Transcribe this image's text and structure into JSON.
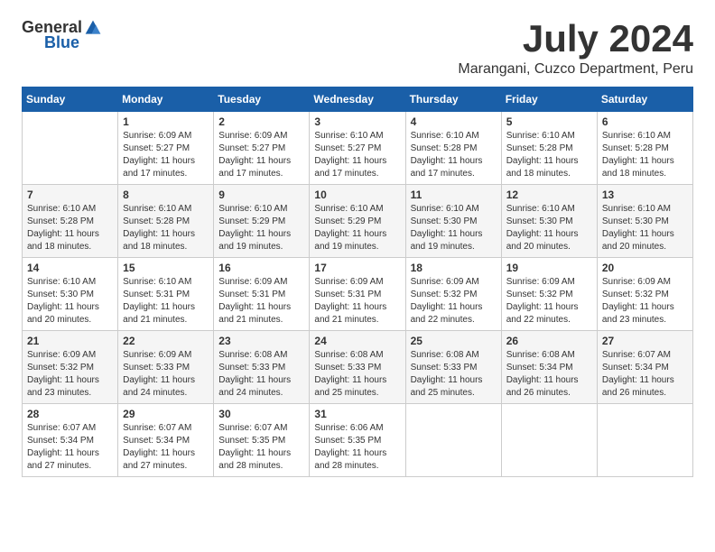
{
  "logo": {
    "text_general": "General",
    "text_blue": "Blue"
  },
  "title": {
    "month_year": "July 2024",
    "location": "Marangani, Cuzco Department, Peru"
  },
  "calendar": {
    "headers": [
      "Sunday",
      "Monday",
      "Tuesday",
      "Wednesday",
      "Thursday",
      "Friday",
      "Saturday"
    ],
    "weeks": [
      [
        {
          "day": "",
          "info": ""
        },
        {
          "day": "1",
          "info": "Sunrise: 6:09 AM\nSunset: 5:27 PM\nDaylight: 11 hours\nand 17 minutes."
        },
        {
          "day": "2",
          "info": "Sunrise: 6:09 AM\nSunset: 5:27 PM\nDaylight: 11 hours\nand 17 minutes."
        },
        {
          "day": "3",
          "info": "Sunrise: 6:10 AM\nSunset: 5:27 PM\nDaylight: 11 hours\nand 17 minutes."
        },
        {
          "day": "4",
          "info": "Sunrise: 6:10 AM\nSunset: 5:28 PM\nDaylight: 11 hours\nand 17 minutes."
        },
        {
          "day": "5",
          "info": "Sunrise: 6:10 AM\nSunset: 5:28 PM\nDaylight: 11 hours\nand 18 minutes."
        },
        {
          "day": "6",
          "info": "Sunrise: 6:10 AM\nSunset: 5:28 PM\nDaylight: 11 hours\nand 18 minutes."
        }
      ],
      [
        {
          "day": "7",
          "info": "Sunrise: 6:10 AM\nSunset: 5:28 PM\nDaylight: 11 hours\nand 18 minutes."
        },
        {
          "day": "8",
          "info": "Sunrise: 6:10 AM\nSunset: 5:28 PM\nDaylight: 11 hours\nand 18 minutes."
        },
        {
          "day": "9",
          "info": "Sunrise: 6:10 AM\nSunset: 5:29 PM\nDaylight: 11 hours\nand 19 minutes."
        },
        {
          "day": "10",
          "info": "Sunrise: 6:10 AM\nSunset: 5:29 PM\nDaylight: 11 hours\nand 19 minutes."
        },
        {
          "day": "11",
          "info": "Sunrise: 6:10 AM\nSunset: 5:30 PM\nDaylight: 11 hours\nand 19 minutes."
        },
        {
          "day": "12",
          "info": "Sunrise: 6:10 AM\nSunset: 5:30 PM\nDaylight: 11 hours\nand 20 minutes."
        },
        {
          "day": "13",
          "info": "Sunrise: 6:10 AM\nSunset: 5:30 PM\nDaylight: 11 hours\nand 20 minutes."
        }
      ],
      [
        {
          "day": "14",
          "info": "Sunrise: 6:10 AM\nSunset: 5:30 PM\nDaylight: 11 hours\nand 20 minutes."
        },
        {
          "day": "15",
          "info": "Sunrise: 6:10 AM\nSunset: 5:31 PM\nDaylight: 11 hours\nand 21 minutes."
        },
        {
          "day": "16",
          "info": "Sunrise: 6:09 AM\nSunset: 5:31 PM\nDaylight: 11 hours\nand 21 minutes."
        },
        {
          "day": "17",
          "info": "Sunrise: 6:09 AM\nSunset: 5:31 PM\nDaylight: 11 hours\nand 21 minutes."
        },
        {
          "day": "18",
          "info": "Sunrise: 6:09 AM\nSunset: 5:32 PM\nDaylight: 11 hours\nand 22 minutes."
        },
        {
          "day": "19",
          "info": "Sunrise: 6:09 AM\nSunset: 5:32 PM\nDaylight: 11 hours\nand 22 minutes."
        },
        {
          "day": "20",
          "info": "Sunrise: 6:09 AM\nSunset: 5:32 PM\nDaylight: 11 hours\nand 23 minutes."
        }
      ],
      [
        {
          "day": "21",
          "info": "Sunrise: 6:09 AM\nSunset: 5:32 PM\nDaylight: 11 hours\nand 23 minutes."
        },
        {
          "day": "22",
          "info": "Sunrise: 6:09 AM\nSunset: 5:33 PM\nDaylight: 11 hours\nand 24 minutes."
        },
        {
          "day": "23",
          "info": "Sunrise: 6:08 AM\nSunset: 5:33 PM\nDaylight: 11 hours\nand 24 minutes."
        },
        {
          "day": "24",
          "info": "Sunrise: 6:08 AM\nSunset: 5:33 PM\nDaylight: 11 hours\nand 25 minutes."
        },
        {
          "day": "25",
          "info": "Sunrise: 6:08 AM\nSunset: 5:33 PM\nDaylight: 11 hours\nand 25 minutes."
        },
        {
          "day": "26",
          "info": "Sunrise: 6:08 AM\nSunset: 5:34 PM\nDaylight: 11 hours\nand 26 minutes."
        },
        {
          "day": "27",
          "info": "Sunrise: 6:07 AM\nSunset: 5:34 PM\nDaylight: 11 hours\nand 26 minutes."
        }
      ],
      [
        {
          "day": "28",
          "info": "Sunrise: 6:07 AM\nSunset: 5:34 PM\nDaylight: 11 hours\nand 27 minutes."
        },
        {
          "day": "29",
          "info": "Sunrise: 6:07 AM\nSunset: 5:34 PM\nDaylight: 11 hours\nand 27 minutes."
        },
        {
          "day": "30",
          "info": "Sunrise: 6:07 AM\nSunset: 5:35 PM\nDaylight: 11 hours\nand 28 minutes."
        },
        {
          "day": "31",
          "info": "Sunrise: 6:06 AM\nSunset: 5:35 PM\nDaylight: 11 hours\nand 28 minutes."
        },
        {
          "day": "",
          "info": ""
        },
        {
          "day": "",
          "info": ""
        },
        {
          "day": "",
          "info": ""
        }
      ]
    ]
  }
}
